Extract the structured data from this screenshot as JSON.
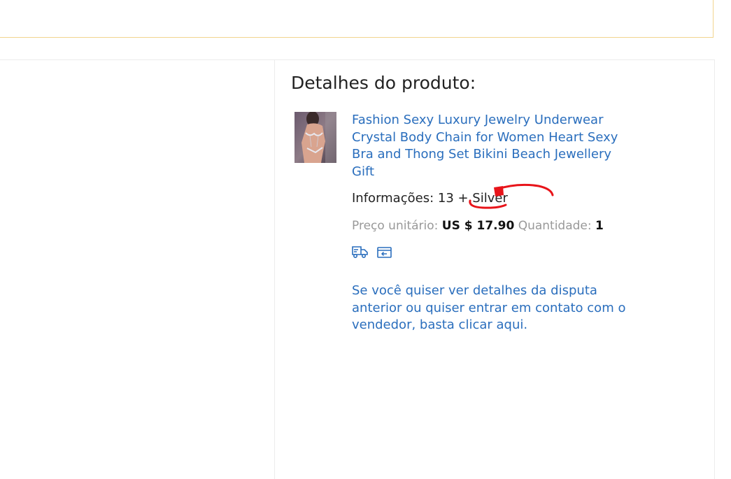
{
  "product_details": {
    "title": "Detalhes do produto:",
    "thumbnail_icon": "product-photo",
    "product_name": "Fashion Sexy Luxury Jewelry Underwear Crystal Body Chain for Women Heart Sexy Bra and Thong Set Bikini Beach Jewellery Gift",
    "info_label": "Informações:",
    "info_value": "13 + Silver",
    "unit_price_label": "Preço unitário:",
    "unit_price_value": "US $ 17.90",
    "quantity_label": "Quantidade:",
    "quantity_value": "1",
    "icons": [
      "shipping-truck-icon",
      "return-box-icon"
    ],
    "dispute_link_text": "Se você quiser ver detalhes da disputa anterior ou quiser entrar em contato com o vendedor, basta clicar aqui."
  },
  "colors": {
    "link": "#2a6ebd",
    "notice_border": "#f2d58f",
    "annotation": "#e8141a"
  }
}
